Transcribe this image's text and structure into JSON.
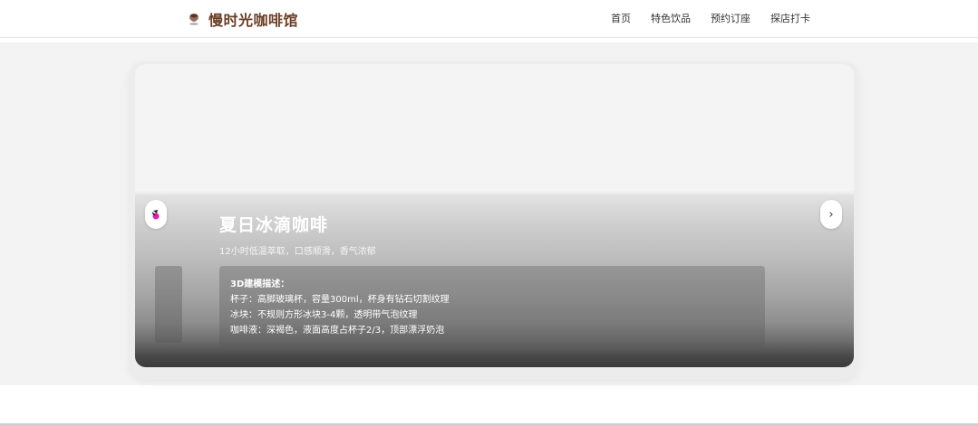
{
  "brand": {
    "name": "慢时光咖啡馆",
    "icon": "coffee-cup-icon"
  },
  "nav": {
    "items": [
      "首页",
      "特色饮品",
      "预约订座",
      "探店打卡"
    ]
  },
  "carousel": {
    "title": "夏日冰滴咖啡",
    "subtitle": "12小时低温萃取，口感顺滑，香气浓郁",
    "description": {
      "title": "3D建模描述：",
      "lines": [
        "杯子：高脚玻璃杯，容量300ml，杯身有钻石切割纹理",
        "冰块：不规则方形冰块3-4颗，透明带气泡纹理",
        "咖啡液：深褐色，液面高度占杯子2/3，顶部漂浮奶泡"
      ]
    },
    "prev_icon": "prev-arrow-icon",
    "next_icon": "chevron-right-icon",
    "next_glyph": "›"
  },
  "colors": {
    "brand": "#6b3e26",
    "hero_bg": "#f3f3f3"
  }
}
